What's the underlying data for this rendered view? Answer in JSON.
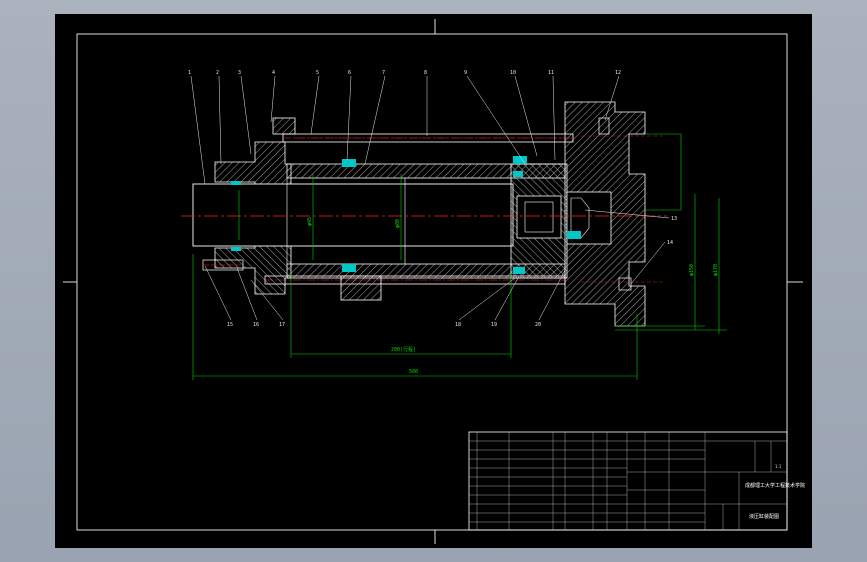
{
  "callouts": [
    "1",
    "2",
    "3",
    "4",
    "5",
    "6",
    "7",
    "8",
    "9",
    "10",
    "11",
    "12"
  ],
  "callouts_lower": [
    "13",
    "14",
    "15",
    "16",
    "17",
    "18",
    "19",
    "20",
    "21",
    "22"
  ],
  "dim_overall": "500",
  "dim_stroke": "200(行程)",
  "dim_bore": "φ80",
  "dim_rod": "φ45",
  "dim_flange_a": "φ150",
  "dim_flange_b": "φ170",
  "title_block": {
    "school": "成都理工大学工程技术学院",
    "drawing_name": "液压缸装配图",
    "scale": "1:1",
    "weight": "",
    "sheet": ""
  },
  "colors": {
    "outline": "#ffffff",
    "section": "#e8e8e8",
    "centerline": "#ff2020",
    "dimension": "#00d000",
    "seal": "#00c8c8",
    "hidden": "#ff2020"
  }
}
